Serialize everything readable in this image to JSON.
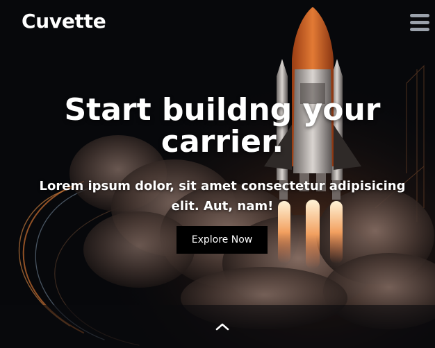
{
  "navbar": {
    "brand": "Cuvette",
    "menu_icon": "hamburger-menu-icon"
  },
  "hero": {
    "headline_line1": "Start buildng your",
    "headline_line2": "carrier.",
    "subtitle_line1": "Lorem ipsum dolor, sit amet consectetur adipisicing",
    "subtitle_line2": "elit. Aut, nam!",
    "cta_label": "Explore Now",
    "background_image": "rocket-launch-illustration",
    "scroll_icon": "chevron-up-icon"
  },
  "colors": {
    "background": "#07080b",
    "text": "#ffffff",
    "button": "#000000",
    "menu_icon": "#9aa1ab",
    "rocket_accent": "#d9662a"
  }
}
